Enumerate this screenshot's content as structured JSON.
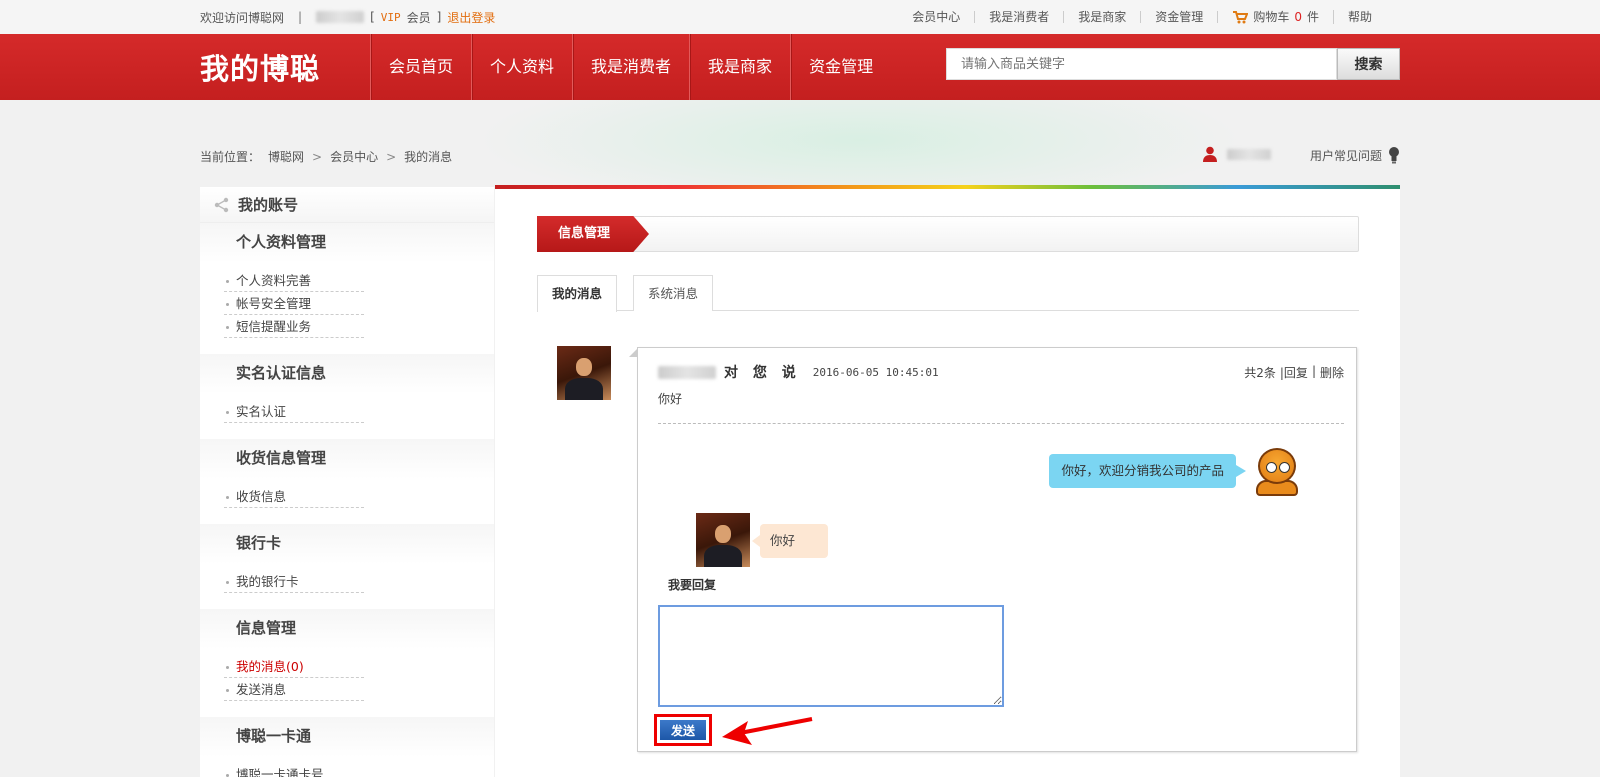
{
  "topbar": {
    "welcome": "欢迎访问博聪网",
    "bracket_open": "[",
    "vip": "VIP",
    "member": "会员",
    "bracket_close": "]",
    "logout": "退出登录",
    "links": [
      "会员中心",
      "我是消费者",
      "我是商家",
      "资金管理"
    ],
    "cart_label": "购物车",
    "cart_count": "0",
    "cart_unit": "件",
    "help": "帮助"
  },
  "nav": {
    "logo": "我的博聪",
    "menu": [
      "会员首页",
      "个人资料",
      "我是消费者",
      "我是商家",
      "资金管理"
    ],
    "search_placeholder": "请输入商品关键字",
    "search_button": "搜索"
  },
  "breadcrumb": {
    "prefix": "当前位置：",
    "items": [
      "博聪网",
      "会员中心",
      "我的消息"
    ]
  },
  "faq_label": "用户常见问题",
  "sidebar": {
    "title": "我的账号",
    "groups": [
      {
        "title": "个人资料管理",
        "items": [
          "个人资料完善",
          "帐号安全管理",
          "短信提醒业务"
        ]
      },
      {
        "title": "实名认证信息",
        "items": [
          "实名认证"
        ]
      },
      {
        "title": "收货信息管理",
        "items": [
          "收货信息"
        ]
      },
      {
        "title": "银行卡",
        "items": [
          "我的银行卡"
        ]
      },
      {
        "title": "信息管理",
        "items": [
          "我的消息(0)",
          "发送消息"
        ]
      },
      {
        "title": "博聪一卡通",
        "items": [
          "博聪一卡通卡号"
        ]
      }
    ]
  },
  "main": {
    "section_title": "信息管理",
    "tabs": [
      "我的消息",
      "系统消息"
    ],
    "message": {
      "says": "对 您 说",
      "time": "2016-06-05 10:45:01",
      "count": "共2条",
      "reply_link": "|回复",
      "sep": "|",
      "delete_link": "删除",
      "first_text": "你好",
      "reply_bubble": "你好，欢迎分销我公司的产品",
      "user_bubble": "你好"
    },
    "reply_label": "我要回复",
    "send_button": "发送"
  }
}
